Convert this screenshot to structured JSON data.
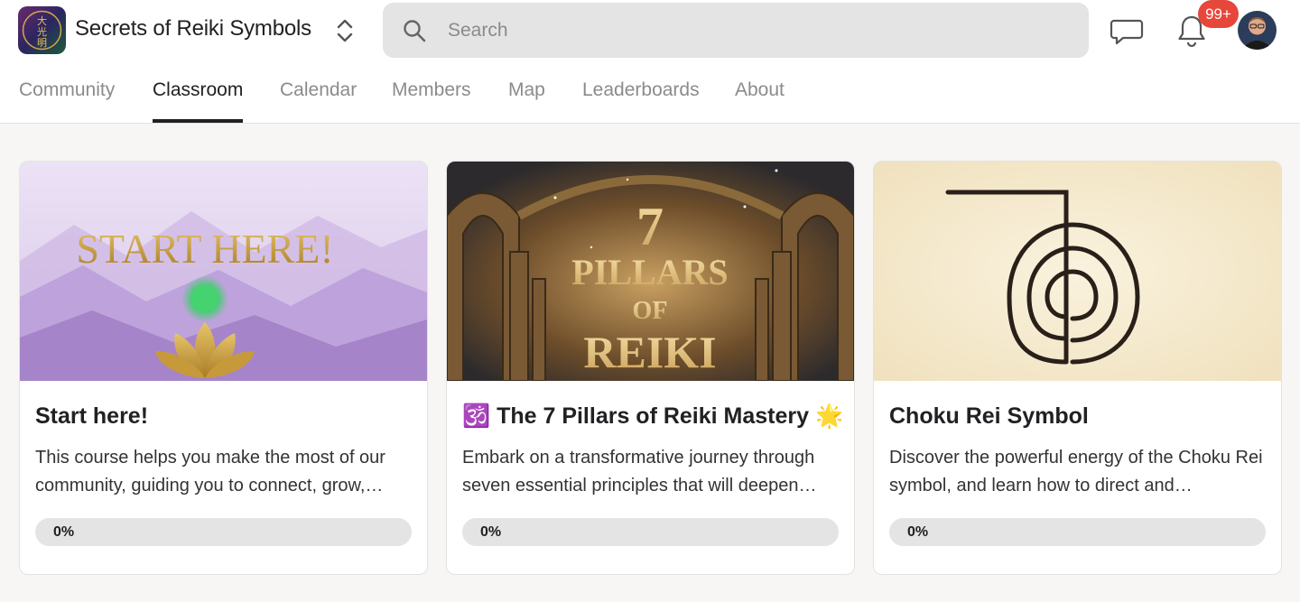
{
  "app": {
    "title": "Secrets of Reiki Symbols",
    "logo_text": "大光明"
  },
  "search": {
    "placeholder": "Search",
    "value": ""
  },
  "notifications": {
    "badge": "99+"
  },
  "nav": {
    "tabs": [
      {
        "label": "Community",
        "active": false
      },
      {
        "label": "Classroom",
        "active": true
      },
      {
        "label": "Calendar",
        "active": false
      },
      {
        "label": "Members",
        "active": false
      },
      {
        "label": "Map",
        "active": false
      },
      {
        "label": "Leaderboards",
        "active": false
      },
      {
        "label": "About",
        "active": false
      }
    ]
  },
  "courses": [
    {
      "title": "Start here!",
      "description": "This course helps you make the most of our community, guiding you to connect, grow,…",
      "progress": "0%",
      "image_text": "START HERE!",
      "image_icon": "lotus-icon"
    },
    {
      "title": "🕉️ The 7 Pillars of Reiki Mastery 🌟",
      "description": "Embark on a transformative journey through seven essential principles that will deepen…",
      "progress": "0%",
      "image_text": {
        "line1": "7",
        "line2": "PILLARS",
        "line3": "OF",
        "line4": "REIKI"
      },
      "image_icon": "arches-icon"
    },
    {
      "title": "Choku Rei Symbol",
      "description": "Discover the powerful energy of the Choku Rei symbol, and learn how to direct and…",
      "progress": "0%",
      "image_icon": "choku-rei-symbol-icon"
    }
  ],
  "colors": {
    "accent": "#202124",
    "badge": "#e7463b",
    "progress_track": "#e4e4e4"
  }
}
